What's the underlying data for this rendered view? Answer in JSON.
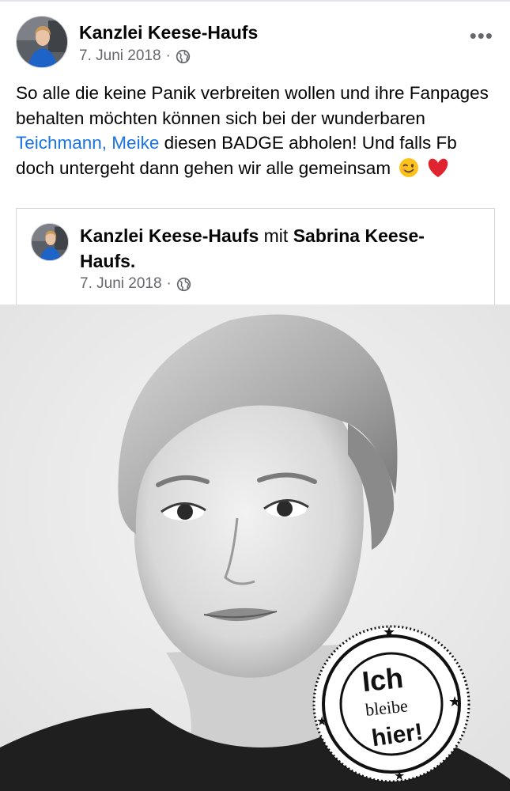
{
  "post": {
    "author": "Kanzlei Keese-Haufs",
    "date": "7. Juni 2018",
    "separator": "·",
    "privacy_icon": "globe-icon",
    "more_label": "•••",
    "text_part1": "So alle die keine Panik verbreiten wollen und ihre Fanpages behalten möchten können sich bei der wunderbaren ",
    "mention": "Teichmann, Meike",
    "text_part2": " diesen BADGE abholen! Und falls Fb doch untergeht dann gehen wir alle gemeinsam",
    "emojis": [
      "winking-face-emoji",
      "red-heart-emoji"
    ]
  },
  "shared": {
    "author": "Kanzlei Keese-Haufs",
    "with_word": "mit",
    "tagged": "Sabrina Keese-Haufs.",
    "date": "7. Juni 2018",
    "separator": "·",
    "privacy_icon": "globe-icon"
  },
  "badge": {
    "line1": "Ich",
    "line2": "bleibe",
    "line3": "hier!"
  },
  "colors": {
    "text": "#050505",
    "secondary": "#65676b",
    "link": "#1b74e4",
    "heart": "#e0242f",
    "avatar_dress": "#1e63c8"
  }
}
